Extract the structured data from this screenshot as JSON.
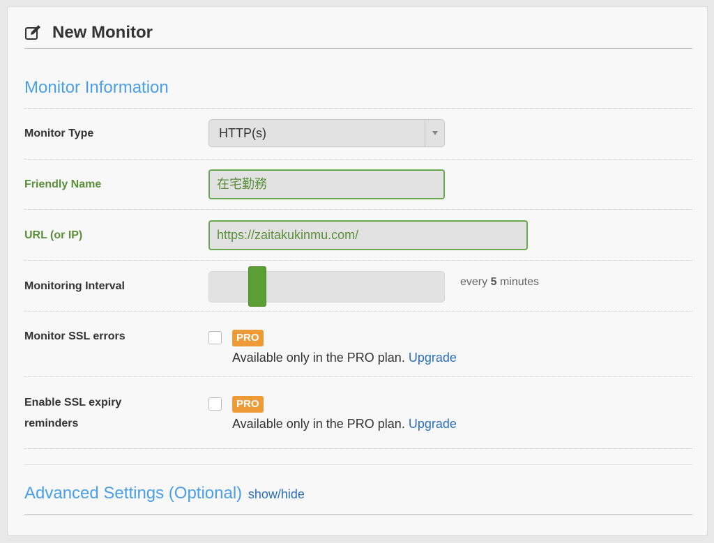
{
  "header": {
    "title": "New Monitor",
    "icon": "edit-icon"
  },
  "monitor_info": {
    "title": "Monitor Information"
  },
  "fields": {
    "monitor_type": {
      "label": "Monitor Type",
      "value": "HTTP(s)"
    },
    "friendly_name": {
      "label": "Friendly Name",
      "value": "在宅勤務"
    },
    "url": {
      "label": "URL (or IP)",
      "value": "https://zaitakukinmu.com/"
    },
    "interval": {
      "label": "Monitoring Interval",
      "prefix": "every",
      "value": "5",
      "suffix": "minutes"
    },
    "ssl_errors": {
      "label": "Monitor SSL errors",
      "badge": "PRO",
      "text": "Available only in the PRO plan.",
      "link": "Upgrade"
    },
    "ssl_expiry": {
      "label_line1": "Enable SSL expiry",
      "label_line2": "reminders",
      "badge": "PRO",
      "text": "Available only in the PRO plan.",
      "link": "Upgrade"
    }
  },
  "advanced": {
    "title": "Advanced Settings (Optional)",
    "toggle": "show/hide"
  },
  "colors": {
    "accent_blue": "#4a9fe8",
    "valid_green": "#5a8f3a",
    "pro_orange": "#ee9a36",
    "link_blue": "#2a6ebb"
  }
}
